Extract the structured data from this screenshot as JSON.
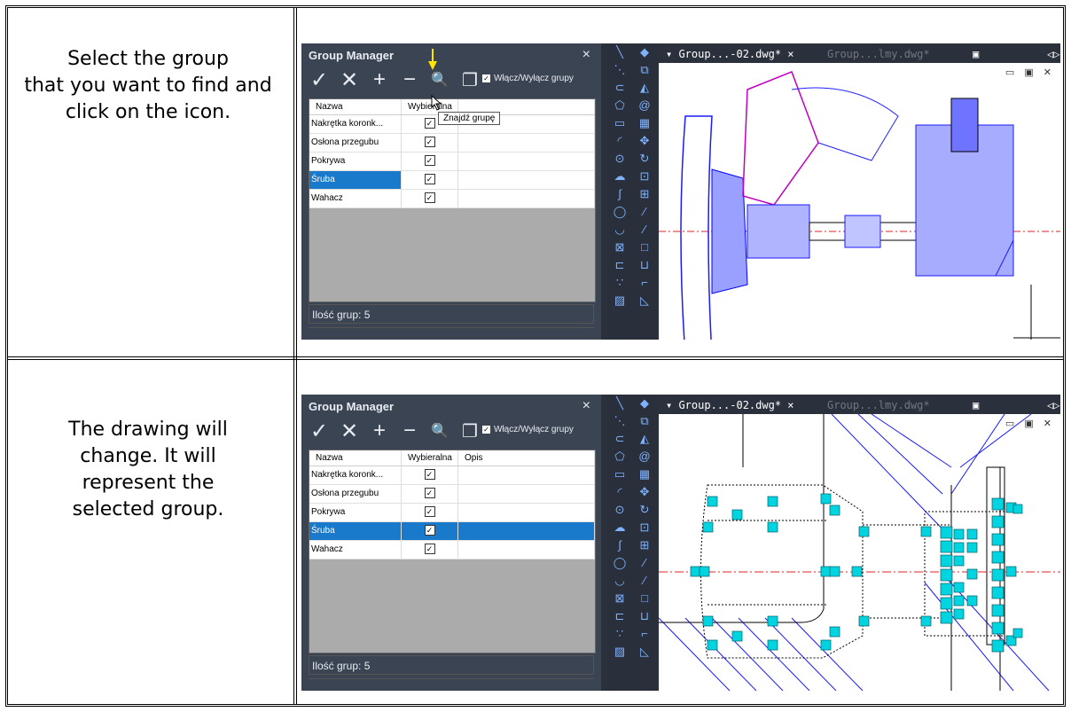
{
  "rows": [
    {
      "instruction": [
        "Select the group",
        "that you want to find and",
        "click on the icon."
      ],
      "show_tooltip": true
    },
    {
      "instruction": [
        "The drawing will",
        "change. It will",
        "represent the",
        "selected group."
      ],
      "show_tooltip": false
    }
  ],
  "panel": {
    "title": "Group Manager",
    "close": "×",
    "toolbar": {
      "accept": "✓",
      "delete": "✕",
      "add": "+",
      "remove": "−",
      "find": "🔍",
      "copy": "❐"
    },
    "toggle_label": "Włącz/Wyłącz grupy",
    "tooltip": "Znajdź grupę",
    "columns": [
      "Nazwa",
      "Wybieralna",
      "Opis"
    ],
    "groups": [
      {
        "name": "Nakrętka koronk...",
        "selectable": "☑"
      },
      {
        "name": "Osłona przegubu",
        "selectable": "☑"
      },
      {
        "name": "Pokrywa",
        "selectable": "☑"
      },
      {
        "name": "Śruba",
        "selectable": "☑"
      },
      {
        "name": "Wahacz",
        "selectable": "☑"
      }
    ],
    "status": "Ilość grup: 5"
  },
  "tabs": {
    "active": "Group...-02.dwg*",
    "active_close": "×",
    "inactive": "Group...lmy.dwg*"
  },
  "window_controls": "▭ ▣ ✕",
  "colors": {
    "panel_bg": "#3b4453",
    "selection": "#1979ca",
    "grip": "#00d4e0",
    "centerline": "#e02020",
    "arrow": "#ffe600"
  }
}
